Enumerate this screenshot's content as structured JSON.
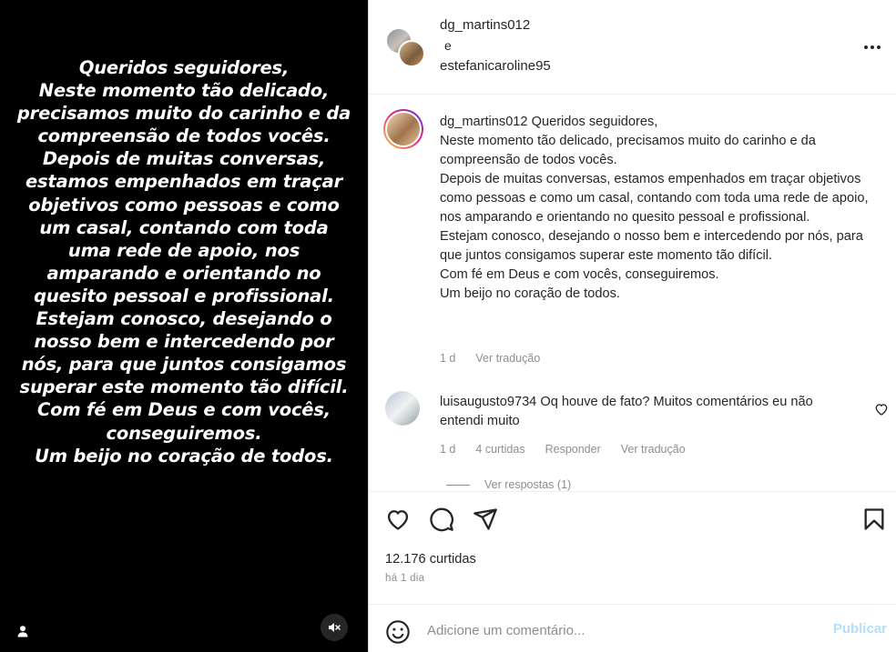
{
  "media": {
    "text": "Queridos seguidores,\nNeste momento tão delicado, precisamos muito do carinho e da compreensão de todos vocês.\nDepois de muitas conversas, estamos empenhados em traçar objetivos como pessoas e como um casal, contando com toda uma rede de apoio, nos amparando e orientando no quesito pessoal e profissional.\nEstejam conosco, desejando o nosso bem e intercedendo por nós, para que juntos consigamos superar este momento tão difícil.\nCom fé em Deus e com vocês, conseguiremos.\nUm beijo no coração de todos.",
    "user_icon": "person-icon",
    "mute_icon": "speaker-muted-icon"
  },
  "header": {
    "user1": "dg_martins012",
    "connector": "e",
    "user2": "estefanicaroline95",
    "more_icon": "more-horizontal-icon"
  },
  "caption": {
    "username": "dg_martins012",
    "text": "Queridos seguidores,\nNeste momento tão delicado, precisamos muito do carinho e da compreensão de todos vocês.\nDepois de muitas conversas, estamos empenhados em traçar objetivos como pessoas e como um casal, contando com toda uma rede de apoio, nos amparando e orientando no quesito pessoal e profissional.\nEstejam conosco, desejando o nosso bem e intercedendo por nós, para que juntos consigamos superar este momento tão difícil.\nCom fé em Deus e com vocês, conseguiremos.\nUm beijo no coração de todos.",
    "age": "1 d",
    "translate": "Ver tradução"
  },
  "comment": {
    "username": "luisaugusto9734",
    "text": "Oq houve de fato? Muitos comentários eu não entendi muito",
    "age": "1 d",
    "likes": "4 curtidas",
    "reply": "Responder",
    "translate": "Ver tradução",
    "view_replies": "Ver respostas (1)"
  },
  "actions": {
    "like_icon": "heart-icon",
    "comment_icon": "comment-icon",
    "share_icon": "paper-plane-icon",
    "save_icon": "bookmark-icon"
  },
  "stats": {
    "likes": "12.176 curtidas",
    "time": "há 1 dia"
  },
  "add_comment": {
    "placeholder": "Adicione um comentário...",
    "publish": "Publicar",
    "emoji_icon": "smiley-icon"
  },
  "colors": {
    "accent_disabled": "#b2dffc",
    "secondary_text": "#8e8e8e"
  }
}
